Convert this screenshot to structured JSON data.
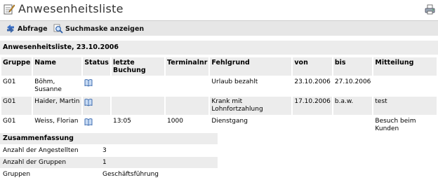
{
  "header": {
    "title": "Anwesenheitsliste",
    "title_icon": "notepad-icon",
    "print_icon": "printer-icon"
  },
  "toolbar": {
    "abfrage_label": "Abfrage",
    "abfrage_icon": "arrows-icon",
    "suchmaske_label": "Suchmaske anzeigen",
    "suchmaske_icon": "search-icon"
  },
  "section": {
    "title": "Anwesenheitsliste, 23.10.2006"
  },
  "table": {
    "headers": {
      "gruppe": "Gruppe",
      "name": "Name",
      "status": "Status",
      "letzte_buchung": "letzte Buchung",
      "terminalnr": "Terminalnr",
      "fehlgrund": "Fehlgrund",
      "von": "von",
      "bis": "bis",
      "mitteilung": "Mitteilung"
    },
    "rows": [
      {
        "gruppe": "G01",
        "name": "Böhm, Susanne",
        "letzte_buchung": "",
        "terminalnr": "",
        "fehlgrund": "Urlaub bezahlt",
        "von": "23.10.2006",
        "bis": "27.10.2006",
        "mitteilung": ""
      },
      {
        "gruppe": "G01",
        "name": "Haider, Martin",
        "letzte_buchung": "",
        "terminalnr": "",
        "fehlgrund": "Krank mit Lohnfortzahlung",
        "von": "17.10.2006",
        "bis": "b.a.w.",
        "mitteilung": "test"
      },
      {
        "gruppe": "G01",
        "name": "Weiss, Florian",
        "letzte_buchung": "13:05",
        "terminalnr": "1000",
        "fehlgrund": "Dienstgang",
        "von": "",
        "bis": "",
        "mitteilung": "Besuch beim Kunden"
      }
    ]
  },
  "summary": {
    "title": "Zusammenfassung",
    "angestellte_label": "Anzahl der Angestellten",
    "angestellte_value": "3",
    "gruppen_count_label": "Anzahl der Gruppen",
    "gruppen_count_value": "1",
    "gruppen_label": "Gruppen",
    "gruppen_value": "Geschäftsführung"
  },
  "colors": {
    "header_bg": "#ececec",
    "toolbar_bg": "#e6e6e6",
    "icon_blue": "#2d5fa8"
  }
}
